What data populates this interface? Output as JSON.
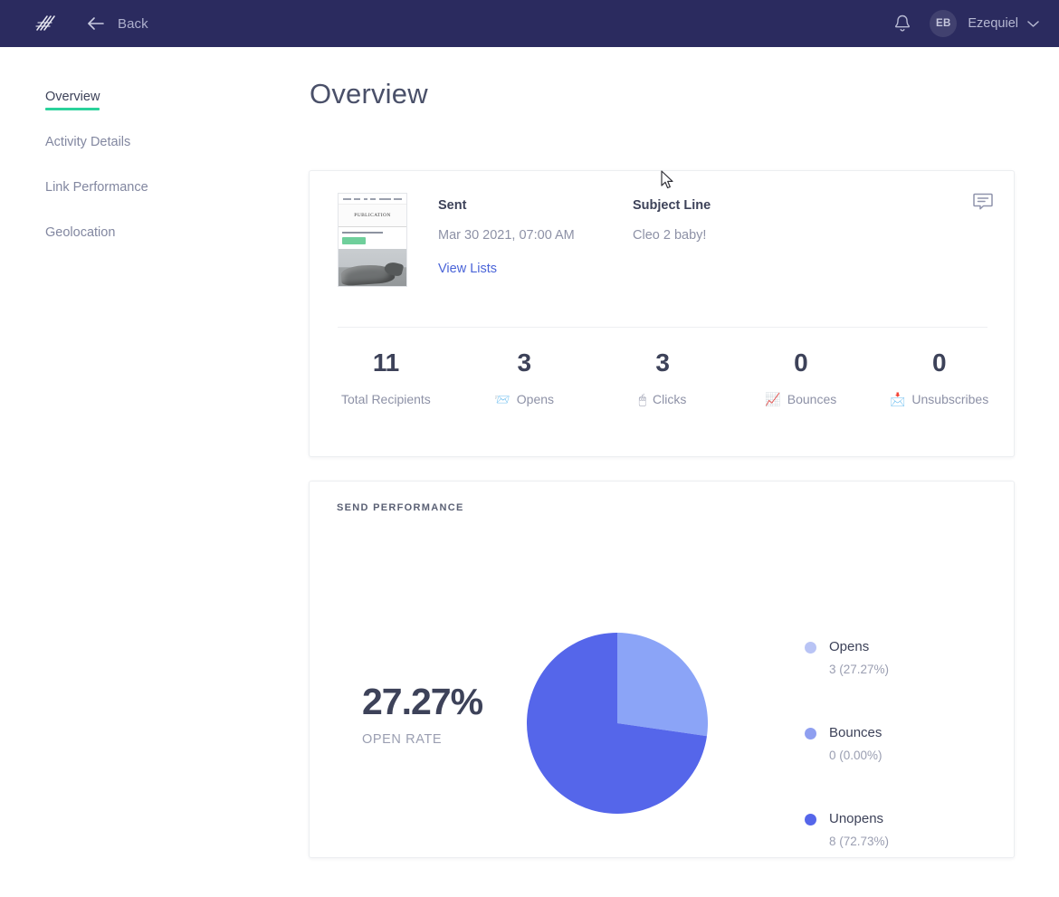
{
  "topbar": {
    "logo_icon": "slashes-logo-icon",
    "back_icon": "arrow-left-icon",
    "back_label": "Back",
    "bell_icon": "bell-icon",
    "avatar_initials": "EB",
    "user_name": "Ezequiel",
    "chevron_icon": "chevron-down-icon",
    "background": "#2b2b5f"
  },
  "sidebar": {
    "items": [
      {
        "label": "Overview",
        "active": true
      },
      {
        "label": "Activity Details",
        "active": false
      },
      {
        "label": "Link Performance",
        "active": false
      },
      {
        "label": "Geolocation",
        "active": false
      }
    ],
    "active_underline_color": "#2ad29b"
  },
  "main": {
    "page_title": "Overview"
  },
  "summary_card": {
    "thumbnail": {
      "name": "email-preview-thumbnail",
      "title": "PUBLICATION"
    },
    "comment_icon": "comment-bubble-icon",
    "sent": {
      "label": "Sent",
      "value": "Mar 30 2021, 07:00 AM",
      "link": "View Lists"
    },
    "subject": {
      "label": "Subject Line",
      "value": "Cleo 2 baby!"
    },
    "stats": [
      {
        "value": "11",
        "label": "Total Recipients",
        "icon": "",
        "icon_name": "none"
      },
      {
        "value": "3",
        "label": "Opens",
        "icon": "📨",
        "icon_name": "envelope-icon"
      },
      {
        "value": "3",
        "label": "Clicks",
        "icon": "🖱",
        "icon_name": "cursor-icon"
      },
      {
        "value": "0",
        "label": "Bounces",
        "icon": "📈",
        "icon_name": "chart-increasing-icon"
      },
      {
        "value": "0",
        "label": "Unsubscribes",
        "icon": "📩",
        "icon_name": "envelope-x-icon"
      }
    ]
  },
  "performance_card": {
    "kicker": "SEND PERFORMANCE",
    "rate_value": "27.27%",
    "rate_label": "OPEN RATE"
  },
  "chart_data": {
    "type": "pie",
    "title": "SEND PERFORMANCE",
    "legend_position": "right",
    "categories": [
      "Opens",
      "Bounces",
      "Unopens"
    ],
    "values": [
      3,
      0,
      8
    ],
    "percentages": [
      27.27,
      0.0,
      72.73
    ],
    "colors": [
      "#8ba4f7",
      "#8f9ff0",
      "#5566ea"
    ],
    "legend": [
      {
        "name": "Opens",
        "value": "3 (27.27%)",
        "color": "#b9c4f5"
      },
      {
        "name": "Bounces",
        "value": "0 (0.00%)",
        "color": "#8f9ff0"
      },
      {
        "name": "Unopens",
        "value": "8 (72.73%)",
        "color": "#5566ea"
      }
    ],
    "slice_colors": {
      "opens": "#8ba4f7",
      "unopens": "#5566ea"
    },
    "center_percent": "27.27%",
    "center_label": "OPEN RATE"
  }
}
